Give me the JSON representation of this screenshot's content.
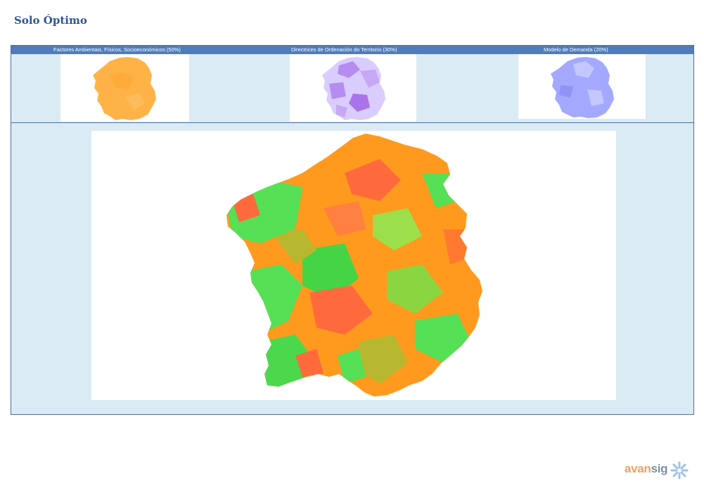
{
  "page": {
    "title": "Solo Óptimo"
  },
  "header": {
    "col1": "Factores Ambientais,  Físicos, Socioeconómicos   (50%)",
    "col2": "Directrices de Ordenación  do Territorio (30%)",
    "col3": "Modelo de Demanda  (20%)"
  },
  "colors": {
    "title": "#2f5597",
    "header_bar": "#4f7dbb",
    "panel_bg": "#daebf3",
    "factor_orange": "#ffb347",
    "directrices_purple": "#b58cf0",
    "directrices_light": "#d9ccff",
    "demanda_blue": "#a4a8ff",
    "optimo_green": "#55e055",
    "optimo_orange": "#ff9a1f",
    "optimo_red": "#ff6a3d",
    "optimo_olive": "#b8b830"
  },
  "logo": {
    "text_a": "avan",
    "text_b": "sig",
    "icon": "snowflake-cross-icon"
  }
}
